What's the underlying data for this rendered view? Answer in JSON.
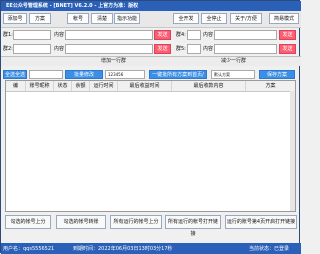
{
  "window": {
    "title": "EE公众号管理系统 - [BNET] V6.2.0 - 上官方为准：版权"
  },
  "toolbar": {
    "buttons": [
      "添加号",
      "方案",
      "帐号",
      "清楚",
      "指示功能",
      "全开发",
      "全停止",
      "关于/方便",
      "简易模式"
    ]
  },
  "send_rows": [
    {
      "label1": "群1:",
      "label2": "内容",
      "send": "发送",
      "label3": "群4:",
      "label4": "内容",
      "send2": "发送"
    },
    {
      "label1": "群2:",
      "label2": "内容",
      "send": "发送",
      "label3": "群5:",
      "label4": "内容",
      "send2": "发送"
    },
    {
      "label1": "群3:",
      "label2": "内容",
      "send": "发送",
      "label3": "群6:",
      "label4": "内容",
      "send2": "发送"
    }
  ],
  "separator": {
    "left": "增加一行群",
    "right": "减少一行群"
  },
  "controls": {
    "left_btn": "全选全选",
    "input_hint": "请选择哪个帐号",
    "mid_btn": "批量修改",
    "mid_input": "123456",
    "long_btn": "一键批所有方案到首页/指定区",
    "dropdown": "默认方案",
    "right_btn": "保存方案"
  },
  "table": {
    "headers": [
      "编",
      "账号昵称",
      "状态",
      "余额",
      "运行时间",
      "最后收益时间",
      "最后收款内容",
      "方案"
    ]
  },
  "bottom_buttons": [
    "勾选的帐号上分",
    "勾选的帐号转账",
    "所有运行的帐号上分",
    "所有运行的帐号打开链接",
    "运行的账号第4页开启打开链接"
  ],
  "status": {
    "user": "用户名：qqs5556521",
    "time": "到期时间：2022年06月03日13时03分17秒",
    "state": "当前状态：已登录"
  }
}
